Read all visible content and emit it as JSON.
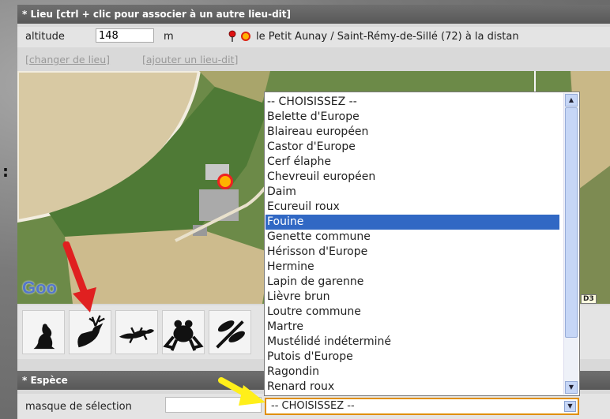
{
  "lieu": {
    "header": "* Lieu [ctrl + clic pour associer à un autre lieu-dit]",
    "altitude_label": "altitude",
    "altitude_value": "148",
    "altitude_unit": "m",
    "place_text": "le Petit Aunay / Saint-Rémy-de-Sillé (72) à la distan",
    "change_link": "[changer de lieu]",
    "add_link": "[ajouter un lieu-dit]"
  },
  "map": {
    "logo": "Goo",
    "road_label": "D3"
  },
  "toolbar": {
    "icons": [
      "bird-icon",
      "deer-icon",
      "lizard-icon",
      "frog-icon",
      "dragonfly-icon"
    ]
  },
  "espece": {
    "header": "* Espèce",
    "mask_label": "masque de sélection",
    "mask_value": "",
    "selected_value": "-- CHOISISSEZ --"
  },
  "dropdown": {
    "options": [
      "-- CHOISISSEZ --",
      "Belette d'Europe",
      "Blaireau européen",
      "Castor d'Europe",
      "Cerf élaphe",
      "Chevreuil européen",
      "Daim",
      "Ecureuil roux",
      "Fouine",
      "Genette commune",
      "Hérisson d'Europe",
      "Hermine",
      "Lapin de garenne",
      "Lièvre brun",
      "Loutre commune",
      "Martre",
      "Mustélidé indéterminé",
      "Putois d'Europe",
      "Ragondin",
      "Renard roux"
    ],
    "highlighted": "Fouine"
  },
  "colors": {
    "header_bg": "#636363",
    "highlight": "#3168c4",
    "select_border": "#e08f00",
    "red_arrow": "#e02020",
    "yellow_arrow": "#ffef1a"
  }
}
